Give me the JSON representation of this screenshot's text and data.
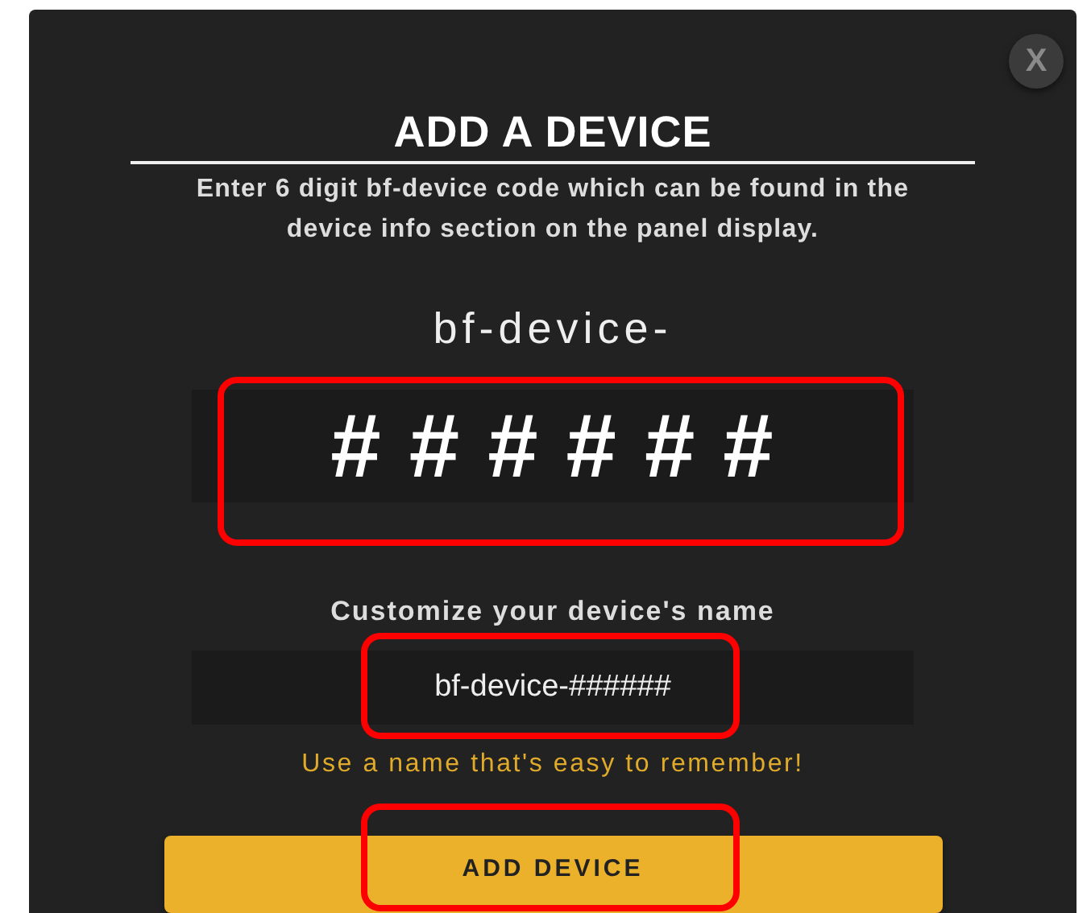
{
  "dialog": {
    "close_label": "X",
    "title": "ADD A DEVICE",
    "description": "Enter 6 digit bf-device code which can be found in the device info section on the panel display.",
    "code_prefix": "bf-device-",
    "code_field": {
      "value": "# # # # # #",
      "highlighted": true
    },
    "name_label": "Customize your device's name",
    "name_field": {
      "value": "bf-device-######",
      "highlighted": true
    },
    "hint": "Use a name that's easy to remember!",
    "submit_button": {
      "label": "ADD DEVICE",
      "highlighted": true
    }
  }
}
